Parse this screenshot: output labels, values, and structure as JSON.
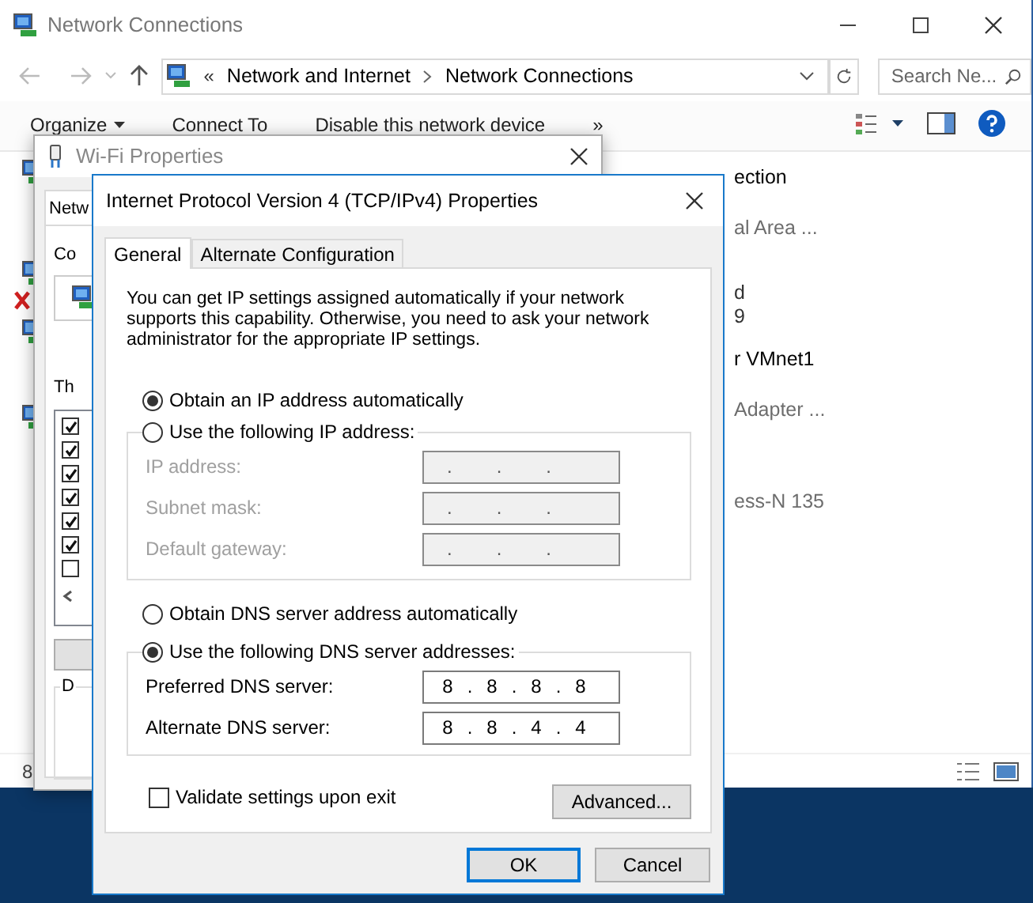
{
  "explorer": {
    "title": "Network Connections",
    "breadcrumb_prefix": "«",
    "breadcrumb": [
      "Network and Internet",
      "Network Connections"
    ],
    "search": {
      "placeholder": "Search Ne..."
    },
    "toolbar": [
      {
        "label": "Organize",
        "kind": "menu"
      },
      {
        "label": "Connect To",
        "kind": "plain"
      },
      {
        "label": "Disable this network device",
        "kind": "plain"
      },
      {
        "label": "»",
        "kind": "plain"
      }
    ],
    "connection_fragments": [
      {
        "text": "ection",
        "kind": "name"
      },
      {
        "text": "al Area ...",
        "kind": "detail"
      },
      {
        "text": "d",
        "kind": "status"
      },
      {
        "text": "9",
        "kind": "status"
      },
      {
        "text": "r VMnet1",
        "kind": "name"
      },
      {
        "text": "Adapter ...",
        "kind": "detail"
      },
      {
        "text": "ess-N 135",
        "kind": "detail"
      }
    ],
    "status_bar": {
      "text": "8"
    }
  },
  "wifi_properties": {
    "title": "Wi-Fi Properties",
    "tab": "Netw",
    "label_1": "Co",
    "label_2": "Th",
    "group_label": "D",
    "items": [
      {
        "checked": true
      },
      {
        "checked": true
      },
      {
        "checked": true
      },
      {
        "checked": true
      },
      {
        "checked": true
      },
      {
        "checked": true
      },
      {
        "checked": false
      }
    ]
  },
  "ipv4_dialog": {
    "title": "Internet Protocol Version 4 (TCP/IPv4) Properties",
    "tabs": [
      {
        "label": "General",
        "selected": true
      },
      {
        "label": "Alternate Configuration",
        "selected": false
      }
    ],
    "description": "You can get IP settings assigned automatically if your network supports this capability. Otherwise, you need to ask your network administrator for the appropriate IP settings.",
    "ip_mode": [
      {
        "label": "Obtain an IP address automatically",
        "selected": true
      },
      {
        "label": "Use the following IP address:",
        "selected": false
      }
    ],
    "ip_fields": [
      {
        "label": "IP address:",
        "value": "...",
        "disabled": true
      },
      {
        "label": "Subnet mask:",
        "value": "...",
        "disabled": true
      },
      {
        "label": "Default gateway:",
        "value": "...",
        "disabled": true
      }
    ],
    "dns_mode": [
      {
        "label": "Obtain DNS server address automatically",
        "selected": false
      },
      {
        "label": "Use the following DNS server addresses:",
        "selected": true
      }
    ],
    "dns_fields": [
      {
        "label": "Preferred DNS server:",
        "value": "8.8.8.8",
        "disabled": false
      },
      {
        "label": "Alternate DNS server:",
        "value": "8.8.4.4",
        "disabled": false
      }
    ],
    "validate": {
      "label": "Validate settings upon exit",
      "checked": false
    },
    "advanced_button": "Advanced...",
    "ok_button": "OK",
    "cancel_button": "Cancel"
  }
}
